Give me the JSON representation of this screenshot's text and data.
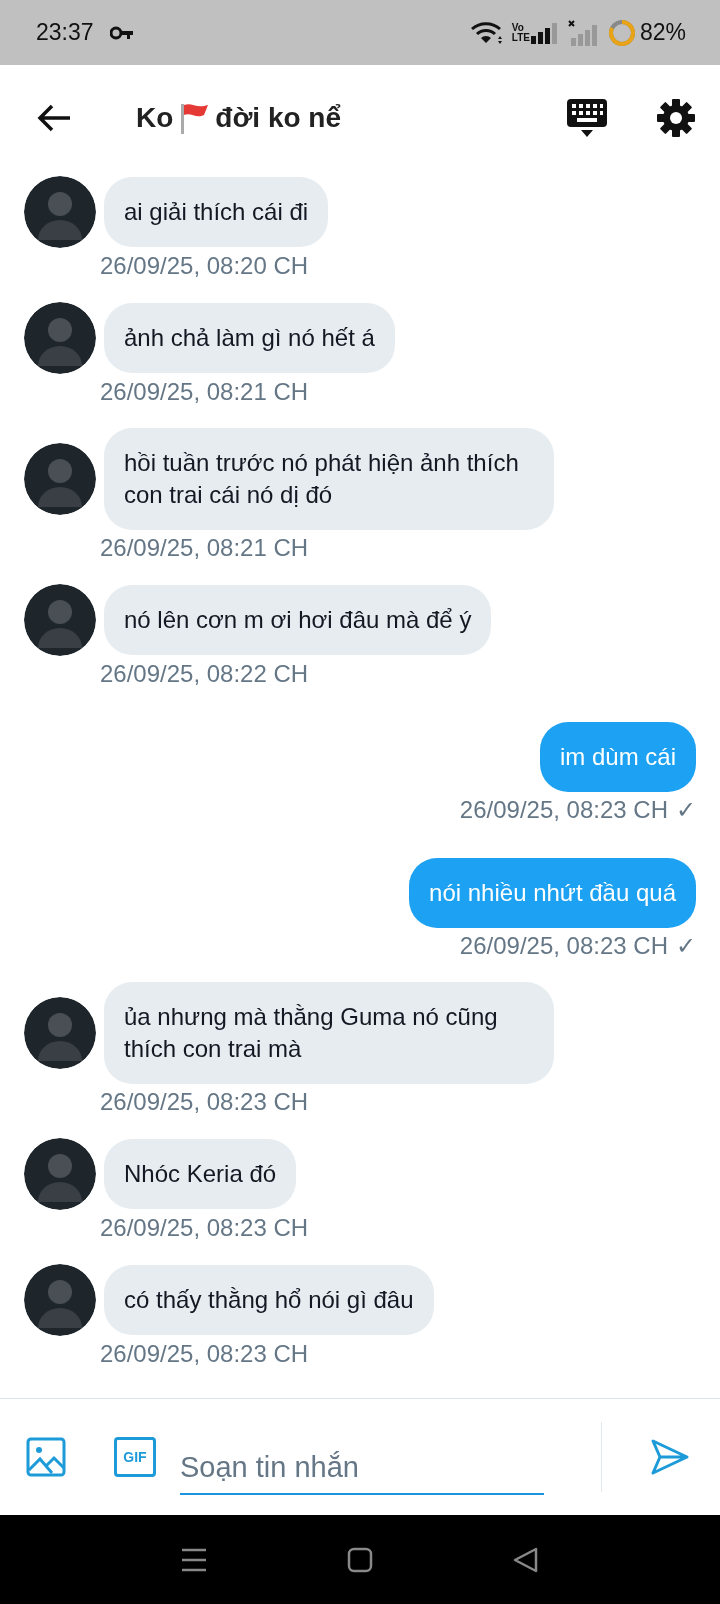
{
  "status_bar": {
    "time": "23:37",
    "volte": [
      "Vo",
      "LTE"
    ],
    "battery": {
      "text": "82%",
      "level": 0.82
    }
  },
  "header": {
    "title_parts": [
      "Ko",
      "đời ko nể"
    ]
  },
  "messages": [
    {
      "kind": "incoming",
      "text": "ai giải thích cái đi",
      "time": "26/09/25, 08:20 CH"
    },
    {
      "kind": "incoming",
      "text": "ảnh chả làm gì nó hết á",
      "time": "26/09/25, 08:21 CH"
    },
    {
      "kind": "incoming",
      "text": "hồi tuần trước nó phát hiện ảnh thích con trai cái nó dị đó",
      "time": "26/09/25, 08:21 CH"
    },
    {
      "kind": "incoming",
      "text": "nó lên cơn m ơi hơi đâu mà để ý",
      "time": "26/09/25, 08:22 CH"
    },
    {
      "kind": "outgoing",
      "text": "im dùm cái",
      "time": "26/09/25, 08:23 CH",
      "status": "✓"
    },
    {
      "kind": "outgoing",
      "text": "nói nhiều nhứt đầu quá",
      "time": "26/09/25, 08:23 CH",
      "status": "✓"
    },
    {
      "kind": "incoming",
      "text": "ủa nhưng mà thằng Guma nó cũng thích con trai mà",
      "time": "26/09/25, 08:23 CH"
    },
    {
      "kind": "incoming",
      "text": "Nhóc Keria đó",
      "time": "26/09/25, 08:23 CH"
    },
    {
      "kind": "incoming",
      "text": "có thấy thằng hổ nói gì đâu",
      "time": "26/09/25, 08:23 CH"
    }
  ],
  "composer": {
    "gif_label": "GIF",
    "placeholder": "Soạn tin nhắn"
  }
}
